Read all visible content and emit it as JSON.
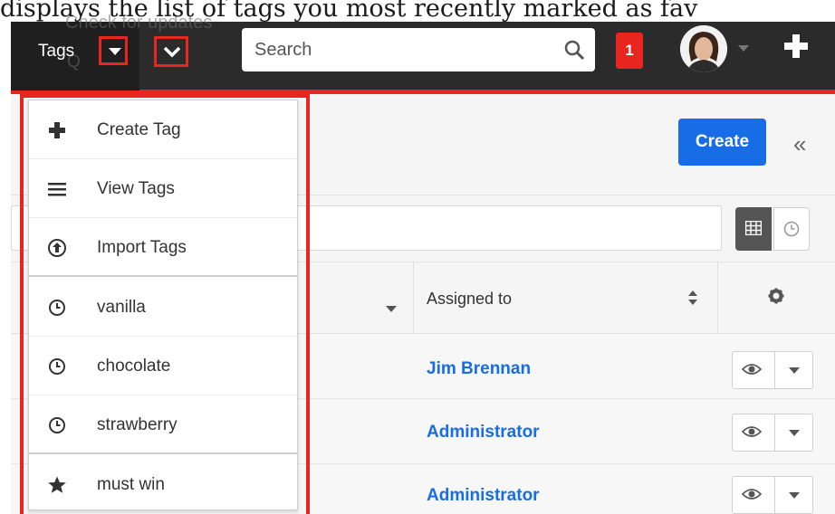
{
  "caption": "displays the list of tags you most recently marked as fav",
  "navbar": {
    "module_label": "Tags",
    "ghost_text": "Check for updates",
    "ghost_text2": "Q",
    "search_placeholder": "Search",
    "notification_count": "1"
  },
  "dropdown": {
    "items": [
      {
        "label": "Create Tag",
        "icon": "plus-icon"
      },
      {
        "label": "View Tags",
        "icon": "list-icon"
      },
      {
        "label": "Import Tags",
        "icon": "upload-circle-icon"
      },
      {
        "label": "vanilla",
        "icon": "clock-icon"
      },
      {
        "label": "chocolate",
        "icon": "clock-icon"
      },
      {
        "label": "strawberry",
        "icon": "clock-icon"
      },
      {
        "label": "must win",
        "icon": "star-icon"
      }
    ]
  },
  "header": {
    "create_label": "Create",
    "collapse_label": "«"
  },
  "table": {
    "assigned_header": "Assigned to",
    "rows": [
      {
        "assigned": "Jim Brennan"
      },
      {
        "assigned": "Administrator"
      },
      {
        "assigned": "Administrator"
      }
    ]
  },
  "colors": {
    "navbar": "#2b2b2b",
    "highlight_red": "#e8251e",
    "primary_blue": "#176de5"
  }
}
